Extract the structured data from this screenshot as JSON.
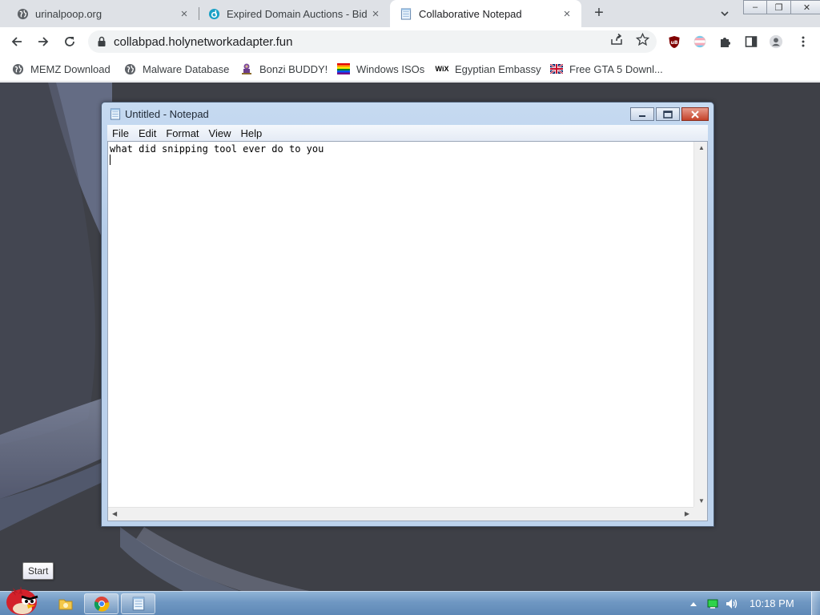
{
  "browser": {
    "tabs": [
      {
        "title": "urinalpoop.org",
        "icon": "globe-icon",
        "close": "×"
      },
      {
        "title": "Expired Domain Auctions - Bid",
        "icon": "godaddy-icon",
        "close": "×"
      },
      {
        "title": "Collaborative Notepad",
        "icon": "notepad-icon",
        "close": "×"
      }
    ],
    "active_tab": 2,
    "new_tab_label": "+",
    "window_controls": {
      "minimize": "–",
      "restore": "❐",
      "close": "✕"
    },
    "address": "collabpad.holynetworkadapter.fun",
    "bookmarks": [
      {
        "label": "MEMZ Download",
        "icon": "globe-icon"
      },
      {
        "label": "Malware Database",
        "icon": "globe-icon"
      },
      {
        "label": "Bonzi BUDDY!",
        "icon": "bonzi-icon"
      },
      {
        "label": "Windows ISOs",
        "icon": "rainbow-flag-icon"
      },
      {
        "label": "Egyptian Embassy",
        "icon": "wix-icon"
      },
      {
        "label": "Free GTA 5 Downl...",
        "icon": "uk-flag-icon"
      }
    ],
    "wix_icon_text": "WiX",
    "ublock_icon_text": "uB"
  },
  "notepad": {
    "title": "Untitled - Notepad",
    "menu": [
      "File",
      "Edit",
      "Format",
      "View",
      "Help"
    ],
    "content": "what did snipping tool ever do to you"
  },
  "desktop": {
    "tooltip": "Start",
    "clock": "10:18 PM"
  },
  "colors": {
    "desktop_bg": "#3e4047",
    "taskbar": "#6f97c2",
    "tab_strip": "#dee1e6"
  }
}
